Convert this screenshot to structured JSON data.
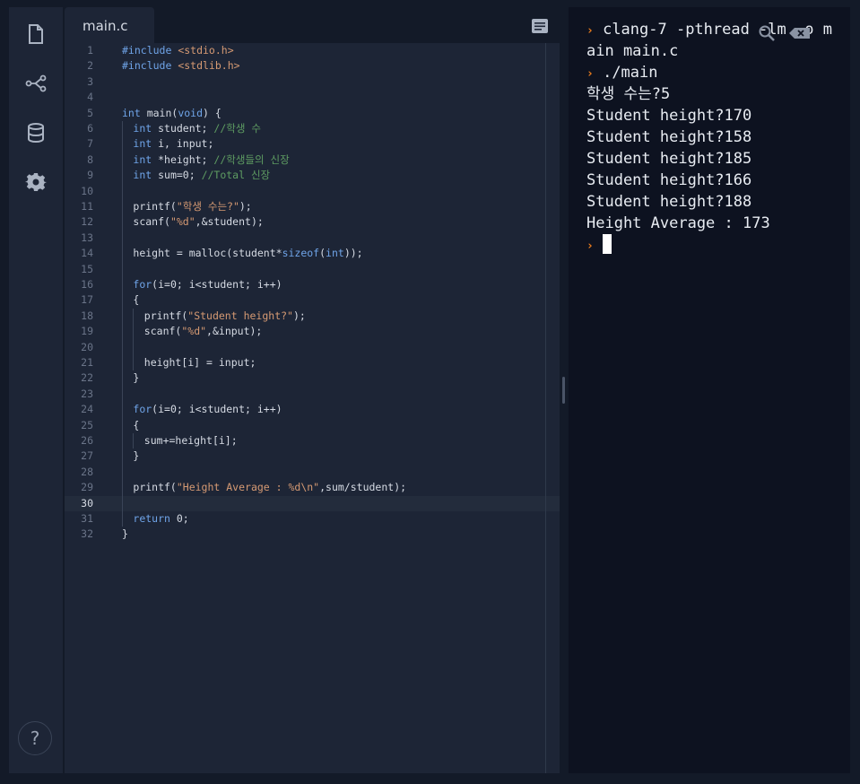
{
  "editor": {
    "tab_label": "main.c",
    "active_line": 30,
    "lines": [
      {
        "n": "1",
        "indent": 0,
        "tokens": [
          {
            "t": "#include ",
            "c": "inc"
          },
          {
            "t": "<stdio.h>",
            "c": "str"
          }
        ]
      },
      {
        "n": "2",
        "indent": 0,
        "tokens": [
          {
            "t": "#include ",
            "c": "inc"
          },
          {
            "t": "<stdlib.h>",
            "c": "str"
          }
        ]
      },
      {
        "n": "3",
        "indent": 0,
        "tokens": []
      },
      {
        "n": "4",
        "indent": 0,
        "tokens": []
      },
      {
        "n": "5",
        "indent": 0,
        "tokens": [
          {
            "t": "int",
            "c": "kw"
          },
          {
            "t": " main(",
            "c": ""
          },
          {
            "t": "void",
            "c": "kw"
          },
          {
            "t": ") {",
            "c": ""
          }
        ]
      },
      {
        "n": "6",
        "indent": 1,
        "tokens": [
          {
            "t": "int",
            "c": "kw"
          },
          {
            "t": " student; ",
            "c": ""
          },
          {
            "t": "//학생 수",
            "c": "cm"
          }
        ]
      },
      {
        "n": "7",
        "indent": 1,
        "tokens": [
          {
            "t": "int",
            "c": "kw"
          },
          {
            "t": " i, input;",
            "c": ""
          }
        ]
      },
      {
        "n": "8",
        "indent": 1,
        "tokens": [
          {
            "t": "int",
            "c": "kw"
          },
          {
            "t": " *height; ",
            "c": ""
          },
          {
            "t": "//학생들의 신장",
            "c": "cm"
          }
        ]
      },
      {
        "n": "9",
        "indent": 1,
        "tokens": [
          {
            "t": "int",
            "c": "kw"
          },
          {
            "t": " sum=0; ",
            "c": ""
          },
          {
            "t": "//Total 신장",
            "c": "cm"
          }
        ]
      },
      {
        "n": "10",
        "indent": 1,
        "tokens": []
      },
      {
        "n": "11",
        "indent": 1,
        "tokens": [
          {
            "t": "printf(",
            "c": ""
          },
          {
            "t": "\"학생 수는?\"",
            "c": "str"
          },
          {
            "t": ");",
            "c": ""
          }
        ]
      },
      {
        "n": "12",
        "indent": 1,
        "tokens": [
          {
            "t": "scanf(",
            "c": ""
          },
          {
            "t": "\"%d\"",
            "c": "str"
          },
          {
            "t": ",&student);",
            "c": ""
          }
        ]
      },
      {
        "n": "13",
        "indent": 1,
        "tokens": []
      },
      {
        "n": "14",
        "indent": 1,
        "tokens": [
          {
            "t": "height = malloc(student*",
            "c": ""
          },
          {
            "t": "sizeof",
            "c": "kw"
          },
          {
            "t": "(",
            "c": ""
          },
          {
            "t": "int",
            "c": "kw"
          },
          {
            "t": "));",
            "c": ""
          }
        ]
      },
      {
        "n": "15",
        "indent": 1,
        "tokens": []
      },
      {
        "n": "16",
        "indent": 1,
        "tokens": [
          {
            "t": "for",
            "c": "kw"
          },
          {
            "t": "(i=0; i<student; i++)",
            "c": ""
          }
        ]
      },
      {
        "n": "17",
        "indent": 1,
        "tokens": [
          {
            "t": "{",
            "c": ""
          }
        ]
      },
      {
        "n": "18",
        "indent": 2,
        "tokens": [
          {
            "t": "printf(",
            "c": ""
          },
          {
            "t": "\"Student height?\"",
            "c": "str"
          },
          {
            "t": ");",
            "c": ""
          }
        ]
      },
      {
        "n": "19",
        "indent": 2,
        "tokens": [
          {
            "t": "scanf(",
            "c": ""
          },
          {
            "t": "\"%d\"",
            "c": "str"
          },
          {
            "t": ",&input);",
            "c": ""
          }
        ]
      },
      {
        "n": "20",
        "indent": 2,
        "tokens": []
      },
      {
        "n": "21",
        "indent": 2,
        "tokens": [
          {
            "t": "height[i] = input;",
            "c": ""
          }
        ]
      },
      {
        "n": "22",
        "indent": 1,
        "tokens": [
          {
            "t": "}",
            "c": ""
          }
        ]
      },
      {
        "n": "23",
        "indent": 1,
        "tokens": []
      },
      {
        "n": "24",
        "indent": 1,
        "tokens": [
          {
            "t": "for",
            "c": "kw"
          },
          {
            "t": "(i=0; i<student; i++)",
            "c": ""
          }
        ]
      },
      {
        "n": "25",
        "indent": 1,
        "tokens": [
          {
            "t": "{",
            "c": ""
          }
        ]
      },
      {
        "n": "26",
        "indent": 2,
        "tokens": [
          {
            "t": "sum+=height[i];",
            "c": ""
          }
        ]
      },
      {
        "n": "27",
        "indent": 1,
        "tokens": [
          {
            "t": "}",
            "c": ""
          }
        ]
      },
      {
        "n": "28",
        "indent": 1,
        "tokens": []
      },
      {
        "n": "29",
        "indent": 1,
        "tokens": [
          {
            "t": "printf(",
            "c": ""
          },
          {
            "t": "\"Height Average : %d\\n\"",
            "c": "str"
          },
          {
            "t": ",sum/student);",
            "c": ""
          }
        ]
      },
      {
        "n": "30",
        "indent": 1,
        "tokens": []
      },
      {
        "n": "31",
        "indent": 1,
        "tokens": [
          {
            "t": "return",
            "c": "kw"
          },
          {
            "t": " 0;",
            "c": ""
          }
        ]
      },
      {
        "n": "32",
        "indent": 0,
        "tokens": [
          {
            "t": "}",
            "c": ""
          }
        ]
      }
    ]
  },
  "terminal": {
    "lines": [
      {
        "prompt": true,
        "text": "clang-7 -pthread -lm -o m"
      },
      {
        "prompt": false,
        "text": "ain main.c"
      },
      {
        "prompt": true,
        "text": "./main"
      },
      {
        "prompt": false,
        "text": "학생 수는?5"
      },
      {
        "prompt": false,
        "text": "Student height?170"
      },
      {
        "prompt": false,
        "text": "Student height?158"
      },
      {
        "prompt": false,
        "text": "Student height?185"
      },
      {
        "prompt": false,
        "text": "Student height?166"
      },
      {
        "prompt": false,
        "text": "Student height?188"
      },
      {
        "prompt": false,
        "text": "Height Average : 173"
      },
      {
        "prompt": true,
        "text": "",
        "cursor": true
      }
    ],
    "prompt_glyph": "›"
  },
  "sidebar": {
    "help_label": "?"
  },
  "colors": {
    "keyword": "#6fa4e8",
    "string": "#d69a73",
    "comment": "#5e9c62",
    "prompt": "#ee7d1d"
  }
}
